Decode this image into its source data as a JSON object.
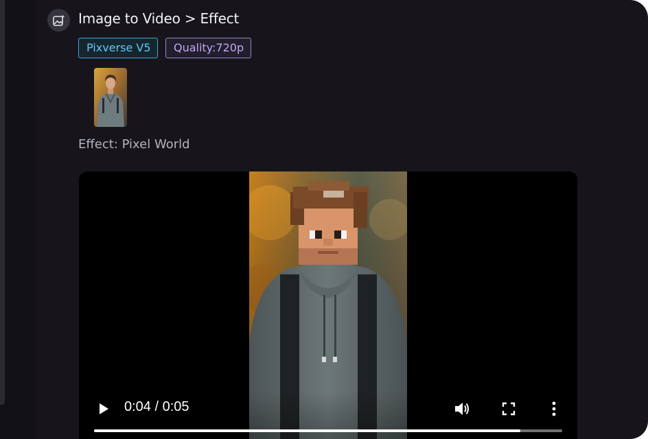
{
  "header": {
    "icon": "image-sparkle-icon",
    "breadcrumb": "Image to Video > Effect"
  },
  "badges": {
    "model": "Pixverse V5",
    "quality": "Quality:720p"
  },
  "source_image": {
    "icon": "portrait-thumbnail"
  },
  "effect": {
    "label": "Effect: Pixel World"
  },
  "player": {
    "time": "0:04 / 0:05",
    "progress": 0.91,
    "icons": {
      "play": "play-icon",
      "volume": "volume-icon",
      "fullscreen": "fullscreen-icon",
      "more": "more-vertical-icon"
    }
  },
  "colors": {
    "background": "#17151b",
    "model_badge": "#3fa7d8",
    "quality_badge": "#9c86c6"
  }
}
